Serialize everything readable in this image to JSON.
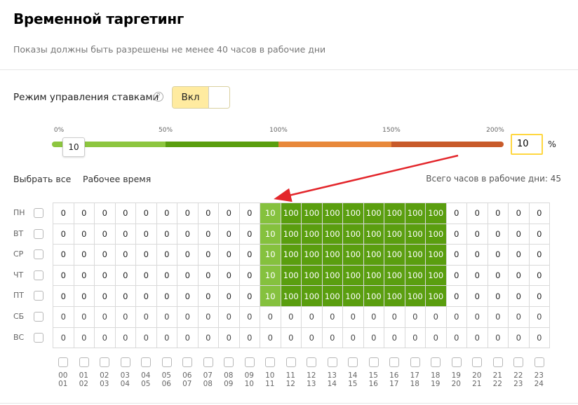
{
  "header": {
    "title": "Временной таргетинг",
    "subtitle": "Показы должны быть разрешены не менее 40 часов в рабочие дни"
  },
  "bid_mode": {
    "label": "Режим управления ставками",
    "help_icon": "question-circle-icon",
    "toggle_label": "Вкл",
    "toggle_on": true
  },
  "slider": {
    "ticks": [
      "0%",
      "50%",
      "100%",
      "150%",
      "200%"
    ],
    "handle_value": "10",
    "value_percent": 10,
    "input_value": "10",
    "percent_sign": "%",
    "segment_colors": [
      "#8dc63f",
      "#5a9e0f",
      "#e8883a",
      "#c85a2a"
    ]
  },
  "actions": {
    "select_all": "Выбрать все",
    "work_time": "Рабочее время",
    "total_hours": "Всего часов в рабочие дни: 45"
  },
  "days": [
    "ПН",
    "ВТ",
    "СР",
    "ЧТ",
    "ПТ",
    "СБ",
    "ВС"
  ],
  "hours": [
    [
      "00",
      "01"
    ],
    [
      "01",
      "02"
    ],
    [
      "02",
      "03"
    ],
    [
      "03",
      "04"
    ],
    [
      "04",
      "05"
    ],
    [
      "05",
      "06"
    ],
    [
      "06",
      "07"
    ],
    [
      "07",
      "08"
    ],
    [
      "08",
      "09"
    ],
    [
      "09",
      "10"
    ],
    [
      "10",
      "11"
    ],
    [
      "11",
      "12"
    ],
    [
      "12",
      "13"
    ],
    [
      "13",
      "14"
    ],
    [
      "14",
      "15"
    ],
    [
      "15",
      "16"
    ],
    [
      "16",
      "17"
    ],
    [
      "17",
      "18"
    ],
    [
      "18",
      "19"
    ],
    [
      "19",
      "20"
    ],
    [
      "20",
      "21"
    ],
    [
      "21",
      "22"
    ],
    [
      "22",
      "23"
    ],
    [
      "23",
      "24"
    ]
  ],
  "grid": [
    [
      "0",
      "0",
      "0",
      "0",
      "0",
      "0",
      "0",
      "0",
      "0",
      "0",
      "10",
      "100",
      "100",
      "100",
      "100",
      "100",
      "100",
      "100",
      "100",
      "0",
      "0",
      "0",
      "0",
      "0"
    ],
    [
      "0",
      "0",
      "0",
      "0",
      "0",
      "0",
      "0",
      "0",
      "0",
      "0",
      "10",
      "100",
      "100",
      "100",
      "100",
      "100",
      "100",
      "100",
      "100",
      "0",
      "0",
      "0",
      "0",
      "0"
    ],
    [
      "0",
      "0",
      "0",
      "0",
      "0",
      "0",
      "0",
      "0",
      "0",
      "0",
      "10",
      "100",
      "100",
      "100",
      "100",
      "100",
      "100",
      "100",
      "100",
      "0",
      "0",
      "0",
      "0",
      "0"
    ],
    [
      "0",
      "0",
      "0",
      "0",
      "0",
      "0",
      "0",
      "0",
      "0",
      "0",
      "10",
      "100",
      "100",
      "100",
      "100",
      "100",
      "100",
      "100",
      "100",
      "0",
      "0",
      "0",
      "0",
      "0"
    ],
    [
      "0",
      "0",
      "0",
      "0",
      "0",
      "0",
      "0",
      "0",
      "0",
      "0",
      "10",
      "100",
      "100",
      "100",
      "100",
      "100",
      "100",
      "100",
      "100",
      "0",
      "0",
      "0",
      "0",
      "0"
    ],
    [
      "0",
      "0",
      "0",
      "0",
      "0",
      "0",
      "0",
      "0",
      "0",
      "0",
      "0",
      "0",
      "0",
      "0",
      "0",
      "0",
      "0",
      "0",
      "0",
      "0",
      "0",
      "0",
      "0",
      "0"
    ],
    [
      "0",
      "0",
      "0",
      "0",
      "0",
      "0",
      "0",
      "0",
      "0",
      "0",
      "0",
      "0",
      "0",
      "0",
      "0",
      "0",
      "0",
      "0",
      "0",
      "0",
      "0",
      "0",
      "0",
      "0"
    ]
  ],
  "colors": {
    "cell_10": "#85c13e",
    "cell_100": "#5a9e0f",
    "toggle_bg": "#ffeba0",
    "input_border": "#ffd740",
    "arrow": "#e3262b"
  }
}
